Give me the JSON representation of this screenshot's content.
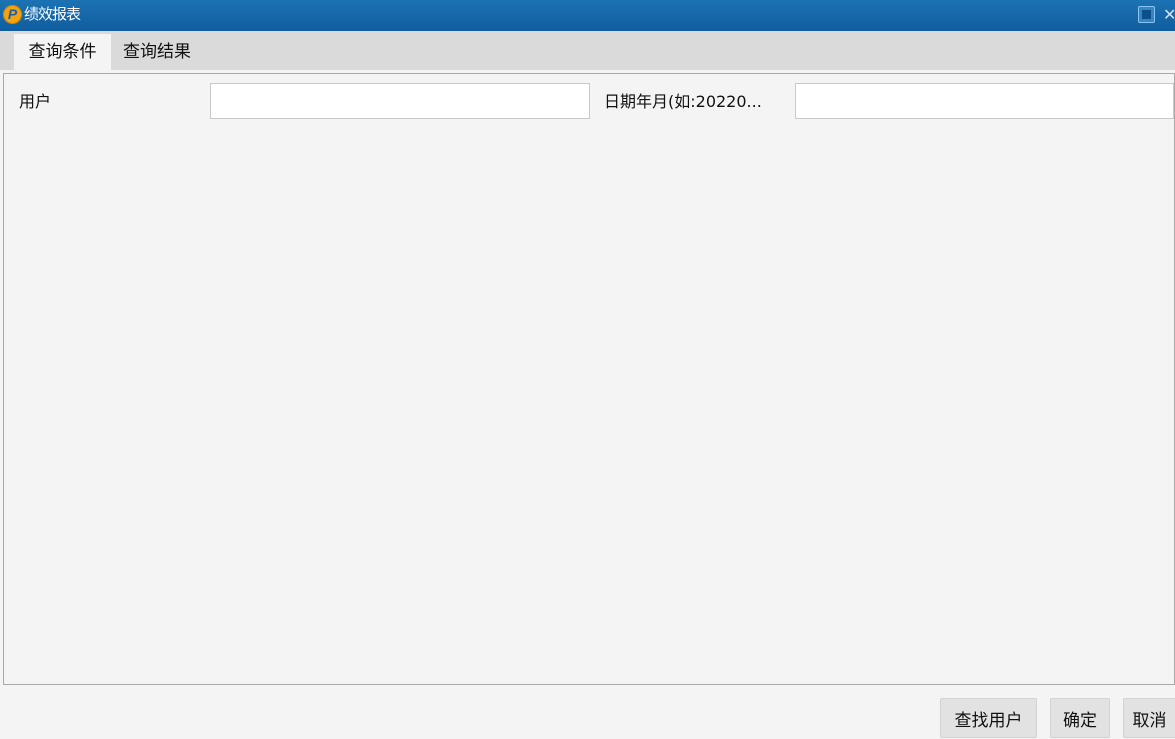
{
  "window": {
    "title": "绩效报表",
    "logo_letter": "P",
    "close_glyph": "✕"
  },
  "tabs": [
    {
      "label": "查询条件",
      "active": true
    },
    {
      "label": "查询结果",
      "active": false
    }
  ],
  "form": {
    "user_label": "用户",
    "user_value": "",
    "date_label": "日期年月(如:20220...",
    "date_value": ""
  },
  "buttons": {
    "find_user": "查找用户",
    "confirm": "确定",
    "cancel": "取消"
  },
  "colors": {
    "titlebar": "#1466a9",
    "background": "#f4f4f4",
    "tabbar": "#dadada",
    "button": "#e2e2e2"
  }
}
